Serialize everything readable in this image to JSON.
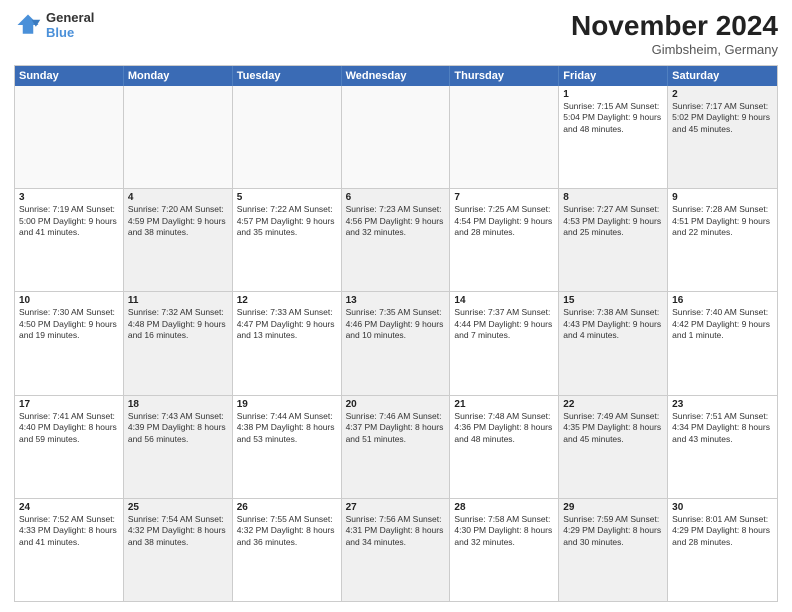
{
  "logo": {
    "line1": "General",
    "line2": "Blue"
  },
  "title": "November 2024",
  "location": "Gimbsheim, Germany",
  "header_days": [
    "Sunday",
    "Monday",
    "Tuesday",
    "Wednesday",
    "Thursday",
    "Friday",
    "Saturday"
  ],
  "rows": [
    [
      {
        "day": "",
        "info": "",
        "empty": true
      },
      {
        "day": "",
        "info": "",
        "empty": true
      },
      {
        "day": "",
        "info": "",
        "empty": true
      },
      {
        "day": "",
        "info": "",
        "empty": true
      },
      {
        "day": "",
        "info": "",
        "empty": true
      },
      {
        "day": "1",
        "info": "Sunrise: 7:15 AM\nSunset: 5:04 PM\nDaylight: 9 hours and 48 minutes.",
        "shaded": false
      },
      {
        "day": "2",
        "info": "Sunrise: 7:17 AM\nSunset: 5:02 PM\nDaylight: 9 hours and 45 minutes.",
        "shaded": true
      }
    ],
    [
      {
        "day": "3",
        "info": "Sunrise: 7:19 AM\nSunset: 5:00 PM\nDaylight: 9 hours and 41 minutes.",
        "shaded": false
      },
      {
        "day": "4",
        "info": "Sunrise: 7:20 AM\nSunset: 4:59 PM\nDaylight: 9 hours and 38 minutes.",
        "shaded": true
      },
      {
        "day": "5",
        "info": "Sunrise: 7:22 AM\nSunset: 4:57 PM\nDaylight: 9 hours and 35 minutes.",
        "shaded": false
      },
      {
        "day": "6",
        "info": "Sunrise: 7:23 AM\nSunset: 4:56 PM\nDaylight: 9 hours and 32 minutes.",
        "shaded": true
      },
      {
        "day": "7",
        "info": "Sunrise: 7:25 AM\nSunset: 4:54 PM\nDaylight: 9 hours and 28 minutes.",
        "shaded": false
      },
      {
        "day": "8",
        "info": "Sunrise: 7:27 AM\nSunset: 4:53 PM\nDaylight: 9 hours and 25 minutes.",
        "shaded": true
      },
      {
        "day": "9",
        "info": "Sunrise: 7:28 AM\nSunset: 4:51 PM\nDaylight: 9 hours and 22 minutes.",
        "shaded": false
      }
    ],
    [
      {
        "day": "10",
        "info": "Sunrise: 7:30 AM\nSunset: 4:50 PM\nDaylight: 9 hours and 19 minutes.",
        "shaded": false
      },
      {
        "day": "11",
        "info": "Sunrise: 7:32 AM\nSunset: 4:48 PM\nDaylight: 9 hours and 16 minutes.",
        "shaded": true
      },
      {
        "day": "12",
        "info": "Sunrise: 7:33 AM\nSunset: 4:47 PM\nDaylight: 9 hours and 13 minutes.",
        "shaded": false
      },
      {
        "day": "13",
        "info": "Sunrise: 7:35 AM\nSunset: 4:46 PM\nDaylight: 9 hours and 10 minutes.",
        "shaded": true
      },
      {
        "day": "14",
        "info": "Sunrise: 7:37 AM\nSunset: 4:44 PM\nDaylight: 9 hours and 7 minutes.",
        "shaded": false
      },
      {
        "day": "15",
        "info": "Sunrise: 7:38 AM\nSunset: 4:43 PM\nDaylight: 9 hours and 4 minutes.",
        "shaded": true
      },
      {
        "day": "16",
        "info": "Sunrise: 7:40 AM\nSunset: 4:42 PM\nDaylight: 9 hours and 1 minute.",
        "shaded": false
      }
    ],
    [
      {
        "day": "17",
        "info": "Sunrise: 7:41 AM\nSunset: 4:40 PM\nDaylight: 8 hours and 59 minutes.",
        "shaded": false
      },
      {
        "day": "18",
        "info": "Sunrise: 7:43 AM\nSunset: 4:39 PM\nDaylight: 8 hours and 56 minutes.",
        "shaded": true
      },
      {
        "day": "19",
        "info": "Sunrise: 7:44 AM\nSunset: 4:38 PM\nDaylight: 8 hours and 53 minutes.",
        "shaded": false
      },
      {
        "day": "20",
        "info": "Sunrise: 7:46 AM\nSunset: 4:37 PM\nDaylight: 8 hours and 51 minutes.",
        "shaded": true
      },
      {
        "day": "21",
        "info": "Sunrise: 7:48 AM\nSunset: 4:36 PM\nDaylight: 8 hours and 48 minutes.",
        "shaded": false
      },
      {
        "day": "22",
        "info": "Sunrise: 7:49 AM\nSunset: 4:35 PM\nDaylight: 8 hours and 45 minutes.",
        "shaded": true
      },
      {
        "day": "23",
        "info": "Sunrise: 7:51 AM\nSunset: 4:34 PM\nDaylight: 8 hours and 43 minutes.",
        "shaded": false
      }
    ],
    [
      {
        "day": "24",
        "info": "Sunrise: 7:52 AM\nSunset: 4:33 PM\nDaylight: 8 hours and 41 minutes.",
        "shaded": false
      },
      {
        "day": "25",
        "info": "Sunrise: 7:54 AM\nSunset: 4:32 PM\nDaylight: 8 hours and 38 minutes.",
        "shaded": true
      },
      {
        "day": "26",
        "info": "Sunrise: 7:55 AM\nSunset: 4:32 PM\nDaylight: 8 hours and 36 minutes.",
        "shaded": false
      },
      {
        "day": "27",
        "info": "Sunrise: 7:56 AM\nSunset: 4:31 PM\nDaylight: 8 hours and 34 minutes.",
        "shaded": true
      },
      {
        "day": "28",
        "info": "Sunrise: 7:58 AM\nSunset: 4:30 PM\nDaylight: 8 hours and 32 minutes.",
        "shaded": false
      },
      {
        "day": "29",
        "info": "Sunrise: 7:59 AM\nSunset: 4:29 PM\nDaylight: 8 hours and 30 minutes.",
        "shaded": true
      },
      {
        "day": "30",
        "info": "Sunrise: 8:01 AM\nSunset: 4:29 PM\nDaylight: 8 hours and 28 minutes.",
        "shaded": false
      }
    ]
  ]
}
